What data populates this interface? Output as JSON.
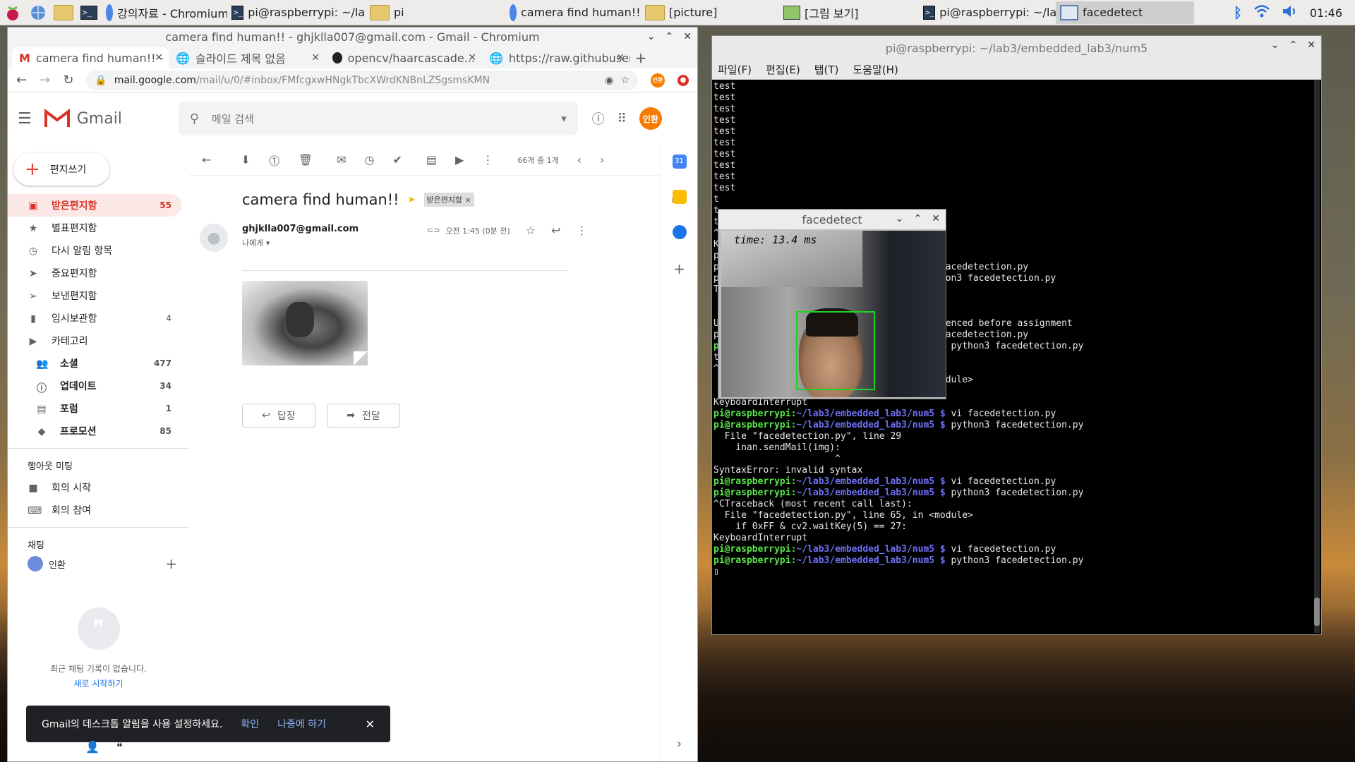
{
  "taskbar": {
    "tasks": [
      {
        "icon": "chromium-icon",
        "label": "강의자료 - Chromium"
      },
      {
        "icon": "terminal-icon",
        "label": "pi@raspberrypi: ~/la..."
      },
      {
        "icon": "folder-icon",
        "label": "pi"
      },
      {
        "icon": "chromium-icon",
        "label": "camera find human!!..."
      },
      {
        "icon": "folder-icon",
        "label": "[picture]"
      },
      {
        "icon": "image-viewer-icon",
        "label": "[그림 보기]"
      },
      {
        "icon": "terminal-icon",
        "label": "pi@raspberrypi: ~/la..."
      },
      {
        "icon": "window-icon",
        "label": "facedetect"
      }
    ],
    "clock": "01:46"
  },
  "chrome": {
    "title": "camera find human!! - ghjklla007@gmail.com - Gmail - Chromium",
    "tabs": [
      {
        "label": "camera find human!! -",
        "icon": "gmail-icon"
      },
      {
        "label": "슬라이드 제목 없음",
        "icon": "globe-icon"
      },
      {
        "label": "opencv/haarcascade...",
        "icon": "github-icon"
      },
      {
        "label": "https://raw.githubuser...",
        "icon": "globe-icon"
      }
    ],
    "url_host": "mail.google.com",
    "url_path": "/mail/u/0/#inbox/FMfcgxwHNgkTbcXWrdKNBnLZSgsmsKMN"
  },
  "gmail": {
    "logo": "Gmail",
    "search_placeholder": "메일 검색",
    "avatar": "인환",
    "compose": "편지쓰기",
    "nav": [
      {
        "label": "받은편지함",
        "count": "55",
        "icon": "inbox-icon",
        "active": true
      },
      {
        "label": "별표편지함",
        "count": "",
        "icon": "star-icon"
      },
      {
        "label": "다시 알림 항목",
        "count": "",
        "icon": "clock-icon"
      },
      {
        "label": "중요편지함",
        "count": "",
        "icon": "important-icon"
      },
      {
        "label": "보낸편지함",
        "count": "",
        "icon": "send-icon"
      },
      {
        "label": "임시보관함",
        "count": "4",
        "icon": "draft-icon"
      },
      {
        "label": "카테고리",
        "count": "",
        "icon": "label-icon"
      }
    ],
    "categories": [
      {
        "label": "소셜",
        "count": "477",
        "icon": "people-icon"
      },
      {
        "label": "업데이트",
        "count": "34",
        "icon": "info-icon"
      },
      {
        "label": "포럼",
        "count": "1",
        "icon": "forum-icon"
      },
      {
        "label": "프로모션",
        "count": "85",
        "icon": "tag-icon"
      }
    ],
    "hangouts_title": "행아웃 미팅",
    "hangouts": [
      {
        "label": "회의 시작",
        "icon": "video-icon"
      },
      {
        "label": "회의 참여",
        "icon": "keyboard-icon"
      }
    ],
    "chat_title": "채팅",
    "chat_user": "인환",
    "chat_empty": "최근 채팅 기록이 없습니다.",
    "chat_start": "새로 시작하기",
    "pager": "66개 중 1개",
    "subject": "camera find human!!",
    "label_chip": "받은편지함 ×",
    "sender": "ghjklla007@gmail.com",
    "to": "나에게 ▾",
    "time": "오전 1:45 (0분 전)",
    "reply": "답장",
    "forward": "전달",
    "toast_msg": "Gmail의 데스크톱 알림을 사용 설정하세요.",
    "toast_ok": "확인",
    "toast_later": "나중에 하기"
  },
  "terminal": {
    "title": "pi@raspberrypi: ~/lab3/embedded_lab3/num5",
    "menu": [
      "파일(F)",
      "편집(E)",
      "탭(T)",
      "도움말(H)"
    ],
    "prompt": "pi@raspberrypi:~/lab3/embedded_lab3/num5 $",
    "lines": [
      {
        "t": "test"
      },
      {
        "t": "test"
      },
      {
        "t": "test"
      },
      {
        "t": "test"
      },
      {
        "t": "test"
      },
      {
        "t": "test"
      },
      {
        "t": "test"
      },
      {
        "t": "test"
      },
      {
        "t": "test"
      },
      {
        "t": "test"
      },
      {
        "t": "t"
      },
      {
        "t": "t"
      },
      {
        "t": "t"
      },
      {
        "t": "^                                   odule>"
      },
      {
        "t": ""
      },
      {
        "t": "K"
      },
      {
        "t": "p                                   $ ^C"
      },
      {
        "t": "p                                   $ vi facedetection.py"
      },
      {
        "t": "p                                   $ python3 facedetection.py"
      },
      {
        "t": "T"
      },
      {
        "t": "                                    odule>"
      },
      {
        "t": ""
      },
      {
        "t": "                                    tect"
      },
      {
        "t": ""
      },
      {
        "t": "U                                    referenced before assignment"
      },
      {
        "t": "p                                   $ vi facedetection.py"
      },
      {
        "p": true,
        "t": " python3 facedetection.py"
      },
      {
        "t": "test"
      },
      {
        "t": "^CTraceback (most recent call last):"
      },
      {
        "t": "  File \"facedetection.py\", line 48, in <module>"
      },
      {
        "t": "    ret, img = cam.read()"
      },
      {
        "t": "KeyboardInterrupt"
      },
      {
        "p": true,
        "t": " vi facedetection.py"
      },
      {
        "p": true,
        "t": " python3 facedetection.py"
      },
      {
        "t": "  File \"facedetection.py\", line 29"
      },
      {
        "t": "    inan.sendMail(img):"
      },
      {
        "t": "                      ^"
      },
      {
        "t": "SyntaxError: invalid syntax"
      },
      {
        "p": true,
        "t": " vi facedetection.py"
      },
      {
        "p": true,
        "t": " python3 facedetection.py"
      },
      {
        "t": "^CTraceback (most recent call last):"
      },
      {
        "t": "  File \"facedetection.py\", line 65, in <module>"
      },
      {
        "t": "    if 0xFF & cv2.waitKey(5) == 27:"
      },
      {
        "t": "KeyboardInterrupt"
      },
      {
        "p": true,
        "t": " vi facedetection.py"
      },
      {
        "p": true,
        "t": " python3 facedetection.py"
      },
      {
        "t": "▯"
      }
    ]
  },
  "facedetect": {
    "title": "facedetect",
    "timing": "time: 13.4 ms",
    "box_color": "#1ed21e"
  },
  "colors": {
    "gmail_red": "#d93025",
    "prompt_green": "#58e64a",
    "prompt_blue": "#6f6ff7"
  }
}
